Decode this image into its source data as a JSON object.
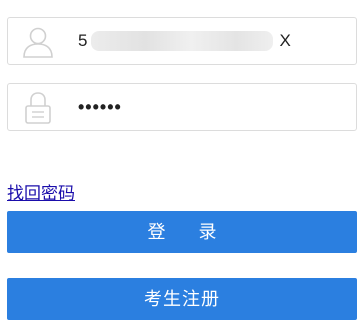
{
  "login_form": {
    "username": {
      "icon": "user-icon",
      "value_prefix": "5",
      "value_suffix": "X"
    },
    "password": {
      "icon": "lock-icon",
      "masked_value": "••••••"
    },
    "forgot_password_link": "找回密码",
    "login_button": "登 录",
    "register_button": "考生注册"
  },
  "colors": {
    "button": "#2b7fe0",
    "link": "#1a0dab",
    "field_border": "#dcdcdc",
    "icon": "#d0d0d0"
  }
}
